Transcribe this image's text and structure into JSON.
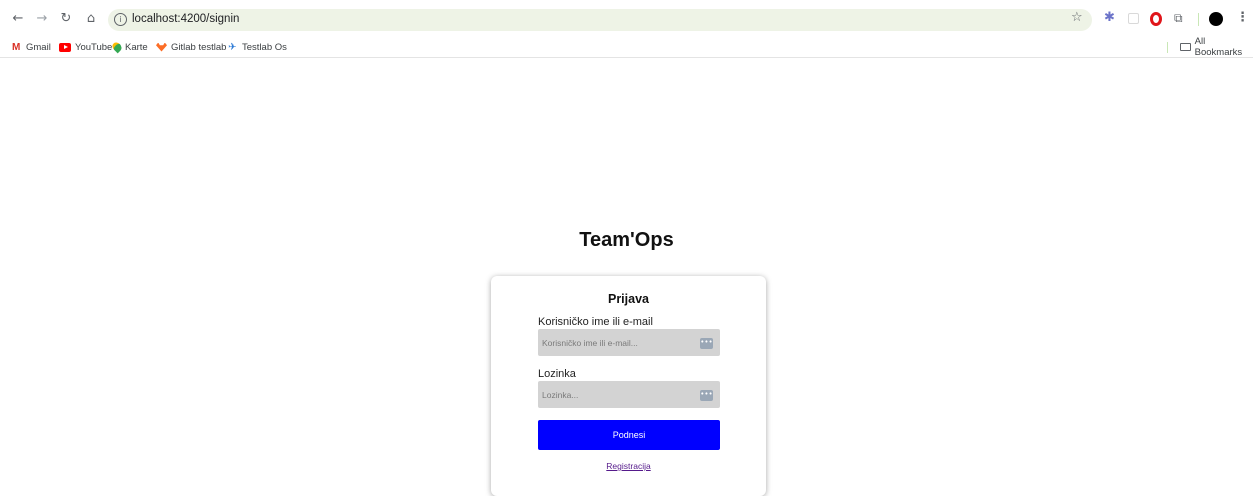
{
  "browser": {
    "url": "localhost:4200/signin",
    "bookmarks": [
      {
        "label": "Gmail",
        "icon": "gmail-icon"
      },
      {
        "label": "YouTube",
        "icon": "youtube-icon"
      },
      {
        "label": "Karte",
        "icon": "maps-icon"
      },
      {
        "label": "Gitlab testlab",
        "icon": "gitlab-icon"
      },
      {
        "label": "Testlab Os",
        "icon": "testlab-icon"
      }
    ],
    "all_bookmarks": "All Bookmarks",
    "colors": {
      "omnibox": "#eef3e6"
    }
  },
  "app": {
    "title": "Team'Ops"
  },
  "login": {
    "heading": "Prijava",
    "username_label": "Korisničko ime ili e-mail",
    "username_placeholder": "Korisničko ime ili e-mail...",
    "username_value": "",
    "password_label": "Lozinka",
    "password_placeholder": "Lozinka...",
    "password_value": "",
    "submit_label": "Podnesi",
    "register_label": "Registracija",
    "colors": {
      "submit": "#0000ff",
      "input_bg": "#d3d3d3"
    }
  }
}
